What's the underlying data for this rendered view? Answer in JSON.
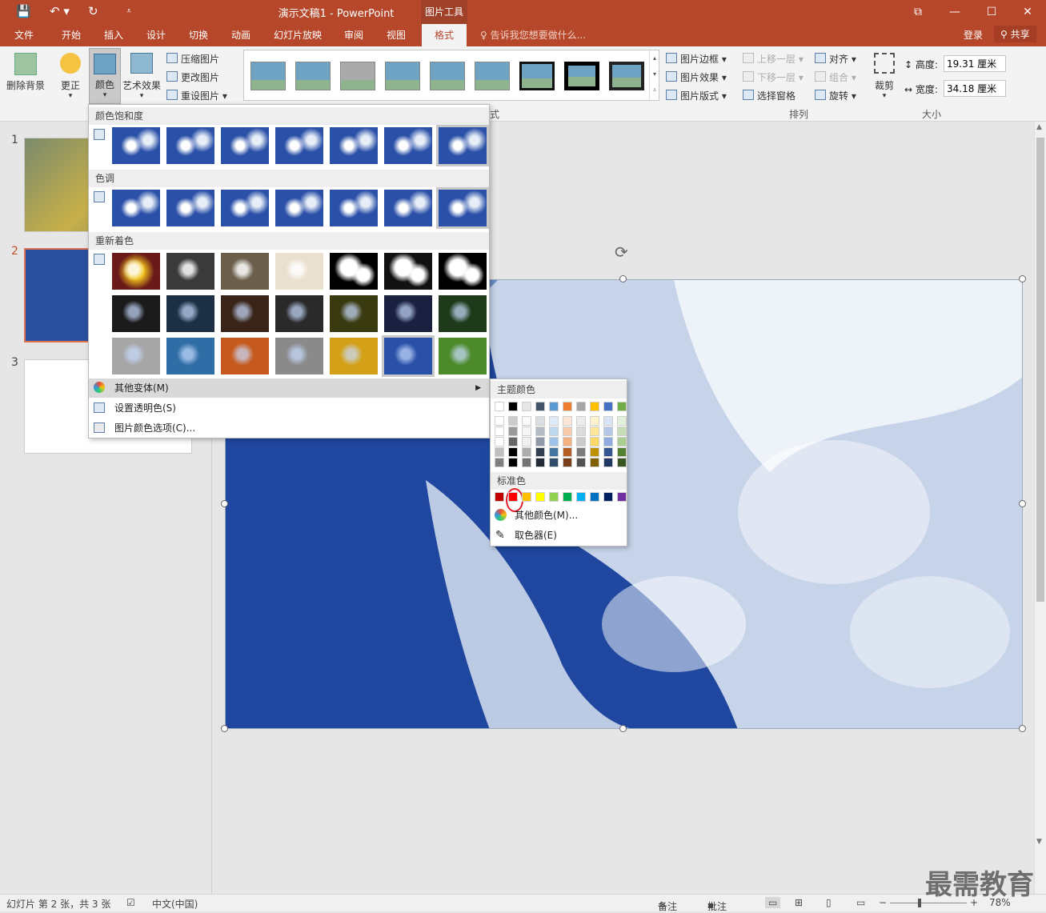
{
  "titlebar": {
    "document_title": "演示文稿1 - PowerPoint",
    "context_label": "图片工具",
    "restore": "⧉",
    "minimize": "—",
    "maximize": "☐",
    "close": "✕"
  },
  "tabs": [
    "文件",
    "开始",
    "插入",
    "设计",
    "切换",
    "动画",
    "幻灯片放映",
    "审阅",
    "视图",
    "格式"
  ],
  "tellme": "告诉我您想要做什么...",
  "account": {
    "login": "登录",
    "share": "共享"
  },
  "ribbon": {
    "adjust": {
      "remove_bg": "删除背景",
      "corrections": "更正",
      "color": "颜色",
      "artistic": "艺术效果",
      "compress": "压缩图片",
      "change": "更改图片",
      "reset": "重设图片"
    },
    "styles": {
      "group_label": "式",
      "border": "图片边框",
      "effects": "图片效果",
      "layout": "图片版式"
    },
    "arrange": {
      "group_label": "排列",
      "forward": "上移一层",
      "backward": "下移一层",
      "selection_pane": "选择窗格",
      "align": "对齐",
      "group": "组合",
      "rotate": "旋转"
    },
    "size": {
      "group_label": "大小",
      "crop": "裁剪",
      "height_label": "高度:",
      "height_value": "19.31 厘米",
      "width_label": "宽度:",
      "width_value": "34.18 厘米"
    }
  },
  "slides": {
    "numbers": [
      "1",
      "2",
      "3"
    ]
  },
  "color_menu": {
    "saturation_header": "颜色饱和度",
    "tone_header": "色调",
    "recolor_header": "重新着色",
    "more_variations": "其他变体(M)",
    "set_transparent": "设置透明色(S)",
    "picture_color_options": "图片颜色选项(C)..."
  },
  "color_submenu": {
    "theme_header": "主题颜色",
    "standard_header": "标准色",
    "more_colors": "其他颜色(M)...",
    "eyedropper": "取色器(E)",
    "theme_colors": [
      "#ffffff",
      "#000000",
      "#e7e6e6",
      "#44546a",
      "#5b9bd5",
      "#ed7d31",
      "#a5a5a5",
      "#ffc000",
      "#4472c4",
      "#70ad47"
    ],
    "standard_colors": [
      "#c00000",
      "#ff0000",
      "#ffc000",
      "#ffff00",
      "#92d050",
      "#00b050",
      "#00b0f0",
      "#0070c0",
      "#002060",
      "#7030a0"
    ],
    "highlight_color": "#e0202a"
  },
  "status": {
    "slide_info": "幻灯片 第 2 张，共 3 张",
    "language": "中文(中国)",
    "notes": "备注",
    "comments": "批注",
    "zoom": "78%"
  },
  "watermark": "最需教育"
}
